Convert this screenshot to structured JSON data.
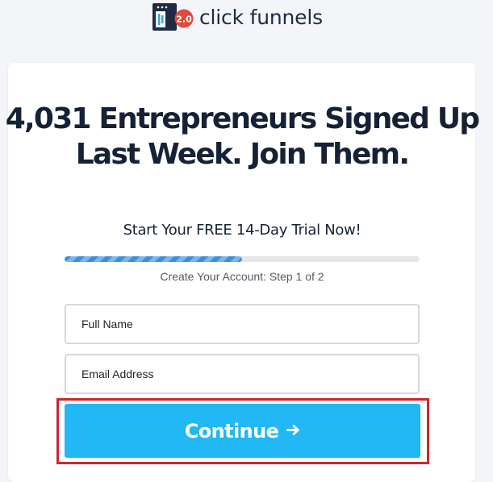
{
  "brand": {
    "name": "click funnels",
    "badge": "2.0",
    "colors": {
      "dark": "#1f2a44",
      "badge": "#e14a3e",
      "accent": "#21b8f5",
      "highlight": "#d0242f"
    }
  },
  "headline": "4,031 Entrepreneurs Signed Up Last Week. Join Them.",
  "subhead": "Start Your FREE 14-Day Trial Now!",
  "progress": {
    "value": 0.5,
    "label": "Create Your Account: Step 1 of 2"
  },
  "form": {
    "full_name_placeholder": "Full Name",
    "email_placeholder": "Email Address",
    "submit_label": "Continue",
    "submit_icon": "arrow-right-icon"
  }
}
